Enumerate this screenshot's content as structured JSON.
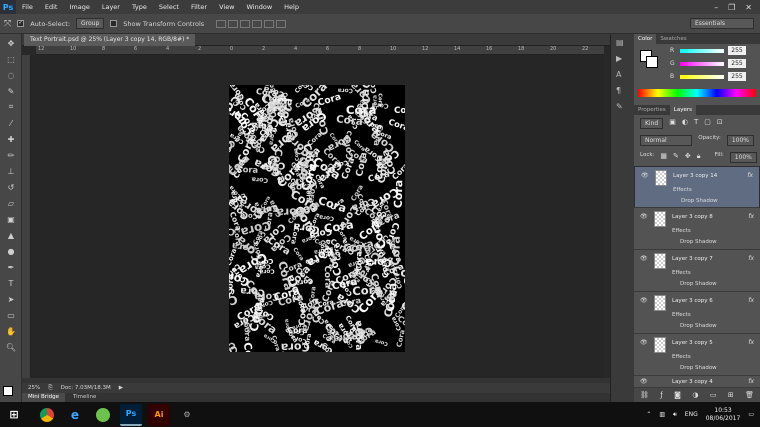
{
  "menubar": {
    "logo": "Ps",
    "items": [
      "File",
      "Edit",
      "Image",
      "Layer",
      "Type",
      "Select",
      "Filter",
      "View",
      "Window",
      "Help"
    ],
    "window_controls": [
      "–",
      "❐",
      "✕"
    ]
  },
  "options": {
    "auto_select_label": "Auto-Select:",
    "auto_select_value": "Group",
    "show_transform_label": "Show Transform Controls",
    "workspace": "Essentials"
  },
  "document": {
    "tab_title": "Text Portrait.psd @ 25% (Layer 3 copy 14, RGB/8#) *",
    "zoom": "25%",
    "doc_size": "Doc: 7.03M/18.3M",
    "ruler_ticks": [
      "12",
      "10",
      "8",
      "6",
      "4",
      "2",
      "0",
      "2",
      "4",
      "6",
      "8",
      "10",
      "12",
      "14",
      "16",
      "18",
      "20",
      "22"
    ],
    "word": "Cora"
  },
  "bottom_tabs": [
    "Mini Bridge",
    "Timeline"
  ],
  "color_panel": {
    "tabs": [
      "Color",
      "Swatches"
    ],
    "r_label": "R",
    "g_label": "G",
    "b_label": "B",
    "r": "255",
    "g": "255",
    "b": "255"
  },
  "layers_panel": {
    "tabs": [
      "Properties",
      "Layers"
    ],
    "kind": "Kind",
    "blend": "Normal",
    "opacity_label": "Opacity:",
    "opacity": "100%",
    "lock_label": "Lock:",
    "fill_label": "Fill:",
    "fill": "100%",
    "layers": [
      {
        "name": "Layer 3 copy 14",
        "effects": "Effects",
        "shadow": "Drop Shadow",
        "fx": "fx"
      },
      {
        "name": "Layer 3 copy 8",
        "effects": "Effects",
        "shadow": "Drop Shadow",
        "fx": "fx"
      },
      {
        "name": "Layer 3 copy 7",
        "effects": "Effects",
        "shadow": "Drop Shadow",
        "fx": "fx"
      },
      {
        "name": "Layer 3 copy 6",
        "effects": "Effects",
        "shadow": "Drop Shadow",
        "fx": "fx"
      },
      {
        "name": "Layer 3 copy 5",
        "effects": "Effects",
        "shadow": "Drop Shadow",
        "fx": "fx"
      },
      {
        "name": "Layer 3 copy 4",
        "fx": "fx"
      }
    ]
  },
  "taskbar": {
    "lang": "ENG",
    "time": "10:53",
    "date": "08/06/2017",
    "ps": "Ps",
    "ai": "Ai"
  }
}
